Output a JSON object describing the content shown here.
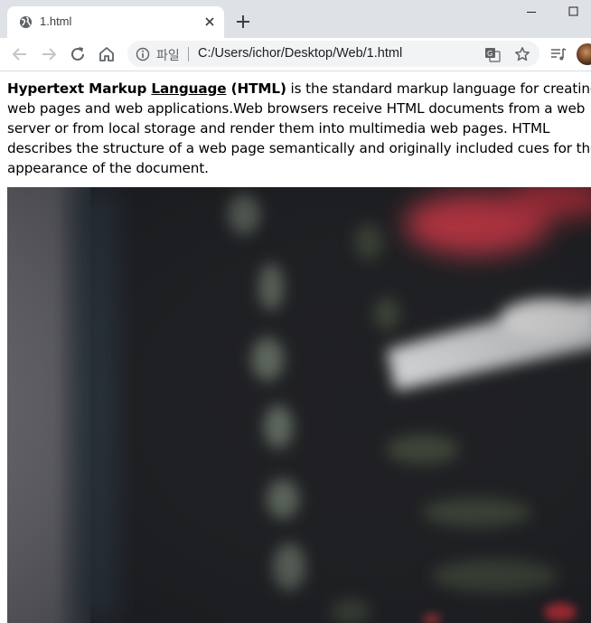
{
  "browser": {
    "tab": {
      "title": "1.html",
      "favicon": "globe-icon"
    },
    "address_bar": {
      "security_label": "파일",
      "url": "C:/Users/ichor/Desktop/Web/1.html"
    },
    "icons": {
      "back": "arrow-left-icon",
      "forward": "arrow-right-icon",
      "reload": "reload-icon",
      "home": "home-icon",
      "info": "info-icon",
      "translate": "translate-icon",
      "bookmark": "star-icon",
      "media": "media-control-icon",
      "new_tab": "plus-icon",
      "close_tab": "close-icon",
      "minimize": "minimize-icon",
      "maximize": "maximize-icon"
    }
  },
  "page": {
    "paragraph": {
      "bold_part1": "Hypertext Markup ",
      "bold_underlined": "Language",
      "bold_part2": " (HTML)",
      "body_text": " is the standard markup language for creating web pages and web applications.Web browsers receive HTML documents from a web server or from local storage and render them into multimedia web pages. HTML describes the structure of a web page semantically and originally included cues for the appearance of the document."
    },
    "image": {
      "description_icon": "blurred-code-photo"
    }
  },
  "colors": {
    "tabstrip_bg": "#dee1e6",
    "omnibox_bg": "#f1f3f4",
    "text": "#000000",
    "photo_red": "#e8384a",
    "photo_dark": "#1c1d20"
  }
}
